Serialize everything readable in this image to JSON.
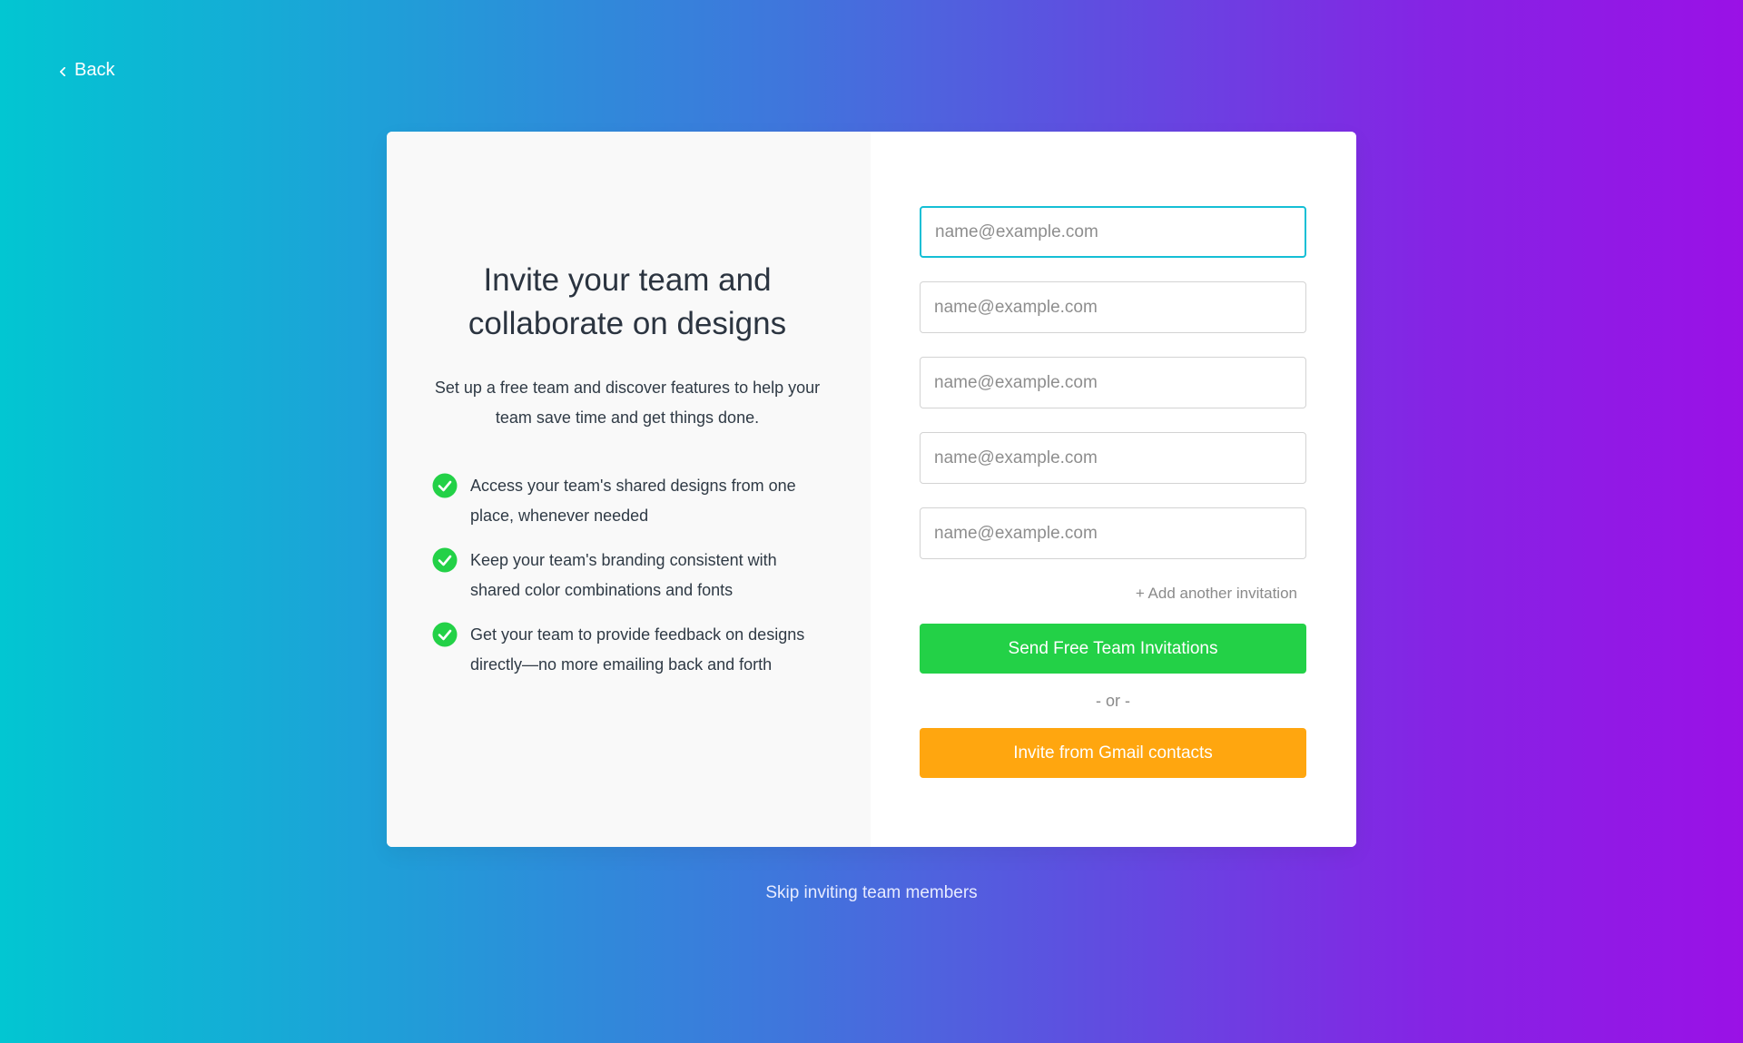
{
  "nav": {
    "back_label": "Back"
  },
  "intro": {
    "headline": "Invite your team and collaborate on designs",
    "subcopy": "Set up a free team and discover features to help your team save time and get things done.",
    "features": [
      {
        "text": "Access your team's shared designs from one place, whenever needed",
        "icon": "check-circle-icon"
      },
      {
        "text": "Keep your team's branding consistent with shared color combinations and fonts",
        "icon": "check-circle-icon"
      },
      {
        "text": "Get your team to provide feedback on designs directly—no more emailing back and forth",
        "icon": "check-circle-icon"
      }
    ]
  },
  "form": {
    "emails": [
      {
        "value": "",
        "placeholder": "name@example.com",
        "focused": true
      },
      {
        "value": "",
        "placeholder": "name@example.com",
        "focused": false
      },
      {
        "value": "",
        "placeholder": "name@example.com",
        "focused": false
      },
      {
        "value": "",
        "placeholder": "name@example.com",
        "focused": false
      },
      {
        "value": "",
        "placeholder": "name@example.com",
        "focused": false
      }
    ],
    "add_another_label": "+ Add another invitation",
    "send_button_label": "Send Free Team Invitations",
    "or_label": "- or -",
    "gmail_button_label": "Invite from Gmail contacts"
  },
  "footer": {
    "skip_label": "Skip inviting team members"
  },
  "colors": {
    "send_button": "#23d147",
    "gmail_button": "#ffa60f",
    "focus_border": "#15bfd5",
    "check_icon": "#23d147"
  }
}
